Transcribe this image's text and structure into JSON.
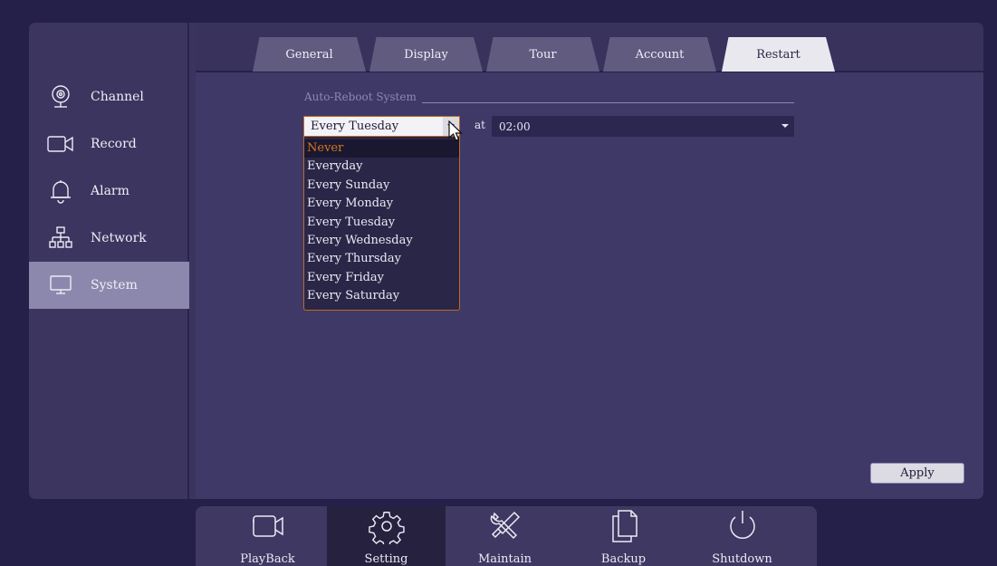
{
  "sidebar": {
    "items": [
      {
        "label": "Channel",
        "icon": "webcam-icon"
      },
      {
        "label": "Record",
        "icon": "video-camera-icon"
      },
      {
        "label": "Alarm",
        "icon": "bell-icon"
      },
      {
        "label": "Network",
        "icon": "network-icon"
      },
      {
        "label": "System",
        "icon": "monitor-icon",
        "active": true
      }
    ]
  },
  "tabs": [
    {
      "label": "General"
    },
    {
      "label": "Display"
    },
    {
      "label": "Tour"
    },
    {
      "label": "Account"
    },
    {
      "label": "Restart",
      "active": true
    }
  ],
  "restart": {
    "section_label": "Auto-Reboot System",
    "day_value": "Every Tuesday",
    "at_label": "at",
    "time_value": "02:00",
    "day_options": [
      "Never",
      "Everyday",
      "Every Sunday",
      "Every Monday",
      "Every Tuesday",
      "Every Wednesday",
      "Every Thursday",
      "Every Friday",
      "Every Saturday"
    ],
    "highlighted_option": "Never"
  },
  "apply_label": "Apply",
  "bottom_nav": {
    "items": [
      {
        "label": "PlayBack",
        "icon": "video-camera-icon"
      },
      {
        "label": "Setting",
        "icon": "gear-icon",
        "active": true
      },
      {
        "label": "Maintain",
        "icon": "tools-icon"
      },
      {
        "label": "Backup",
        "icon": "documents-icon"
      },
      {
        "label": "Shutdown",
        "icon": "power-icon"
      }
    ]
  },
  "colors": {
    "background": "#25204a",
    "panel": "#3f3968",
    "accent_orange": "#d7781f",
    "active_sidebar": "#8c88ad"
  }
}
